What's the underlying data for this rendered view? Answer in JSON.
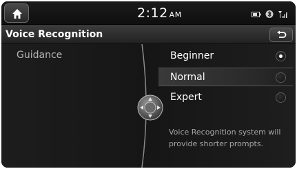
{
  "status_bar": {
    "time": "2:12",
    "ampm": "AM",
    "icons": [
      "battery-icon",
      "bluetooth-icon",
      "signal-icon"
    ]
  },
  "title_bar": {
    "title": "Voice Recognition",
    "back_icon": "back-arrow-icon"
  },
  "left_pane": {
    "label": "Guidance"
  },
  "options": [
    {
      "label": "Beginner",
      "checked": true
    },
    {
      "label": "Normal",
      "checked": false,
      "highlighted": true
    },
    {
      "label": "Expert",
      "checked": false
    }
  ],
  "description": "Voice Recognition system will provide shorter prompts."
}
